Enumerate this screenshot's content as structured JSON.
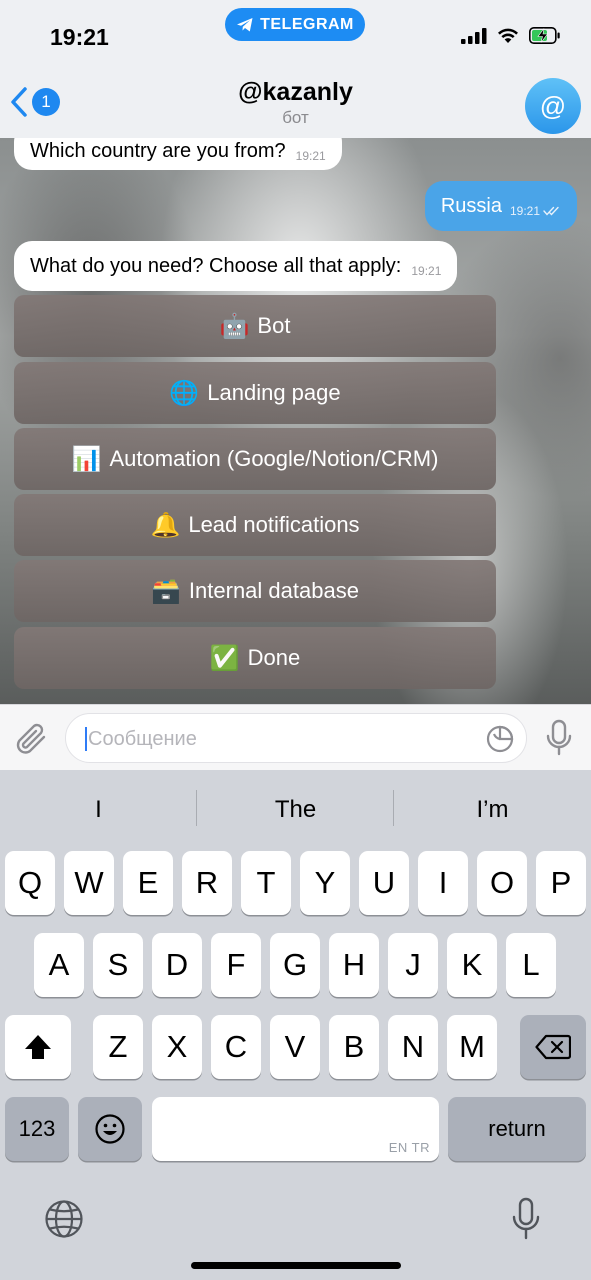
{
  "status_bar": {
    "time": "19:21",
    "pill_label": "TELEGRAM"
  },
  "header": {
    "back_count": "1",
    "title": "@kazanly",
    "subtitle": "бот",
    "avatar_glyph": "@"
  },
  "messages": [
    {
      "direction": "in",
      "text": "Which country are you from?",
      "time": "19:21"
    },
    {
      "direction": "out",
      "text": "Russia",
      "time": "19:21"
    },
    {
      "direction": "in",
      "text": "What do you need? Choose all that apply:",
      "time": "19:21"
    }
  ],
  "inline_keyboard": [
    {
      "emoji": "🤖",
      "label": "Bot"
    },
    {
      "emoji": "🌐",
      "label": "Landing page"
    },
    {
      "emoji": "📊",
      "label": "Automation (Google/Notion/CRM)"
    },
    {
      "emoji": "🔔",
      "label": "Lead notifications"
    },
    {
      "emoji": "🗃️",
      "label": "Internal database"
    },
    {
      "emoji": "✅",
      "label": "Done"
    }
  ],
  "input": {
    "placeholder": "Сообщение"
  },
  "keyboard": {
    "suggestions": [
      "I",
      "The",
      "I’m"
    ],
    "row1": [
      "Q",
      "W",
      "E",
      "R",
      "T",
      "Y",
      "U",
      "I",
      "O",
      "P"
    ],
    "row2": [
      "A",
      "S",
      "D",
      "F",
      "G",
      "H",
      "J",
      "K",
      "L"
    ],
    "row3": [
      "Z",
      "X",
      "C",
      "V",
      "B",
      "N",
      "M"
    ],
    "numbers_key": "123",
    "return_key": "return",
    "space_lang": "EN TR"
  },
  "colors": {
    "accent": "#1e88f0",
    "outgoing_bubble": "#4aa4e8",
    "keyboard_bg": "#d1d4da"
  }
}
